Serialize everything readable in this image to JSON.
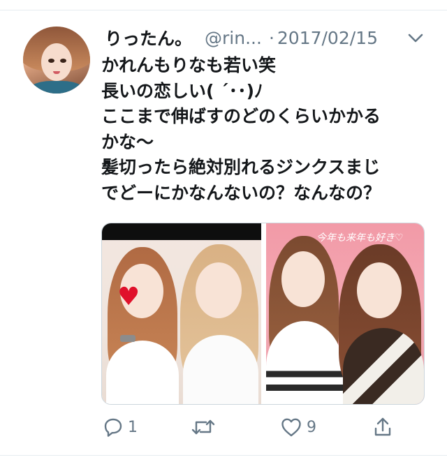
{
  "tweet": {
    "display_name": "りったん。",
    "handle": "@rin...",
    "separator": "·",
    "date": "2017/02/15",
    "text_lines": [
      "かれんもりなも若い笑",
      "長いの恋しい( ´･･)ﾉ",
      "ここまで伸ばすのどのくらいかかる",
      "かな〜",
      "髪切ったら絶対別れるジンクスまじ",
      "でどーにかなんないの？なんなの？"
    ],
    "photo_right_caption": "今年も来年も好き♡",
    "actions": {
      "reply_count": "1",
      "retweet_count": "",
      "like_count": "9"
    }
  },
  "icons": {
    "menu": "chevron-down-icon",
    "reply": "reply-icon",
    "retweet": "retweet-icon",
    "like": "heart-icon",
    "share": "share-icon"
  },
  "colors": {
    "text": "#14171a",
    "secondary": "#657786",
    "divider": "#e6ecf0"
  }
}
